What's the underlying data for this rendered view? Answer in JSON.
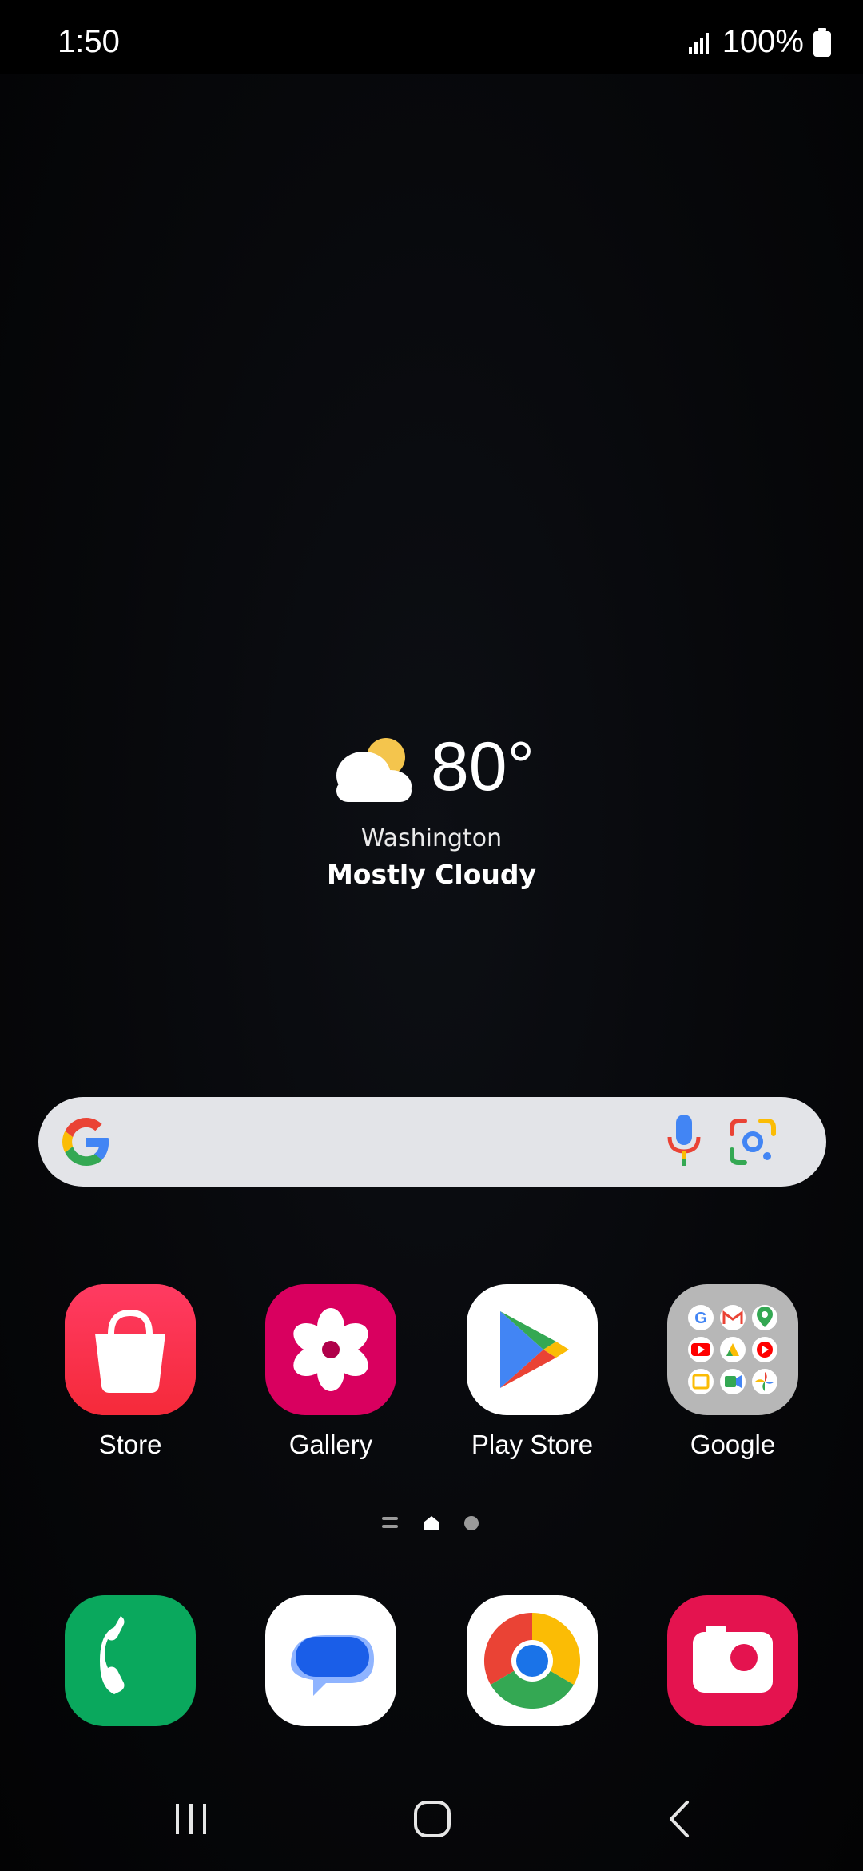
{
  "status_bar": {
    "time": "1:50",
    "battery": "100%",
    "icons": [
      "signal-icon",
      "battery-icon"
    ]
  },
  "weather": {
    "temperature": "80°",
    "city": "Washington",
    "condition": "Mostly Cloudy",
    "icon": "partly-cloudy-icon"
  },
  "search": {
    "icons": [
      "google-logo-icon",
      "microphone-icon",
      "google-lens-icon"
    ]
  },
  "apps": [
    {
      "label": "Store",
      "icon": "store-bag-icon",
      "color": "#ff2a57"
    },
    {
      "label": "Gallery",
      "icon": "gallery-flower-icon",
      "color": "#d9005f"
    },
    {
      "label": "Play Store",
      "icon": "play-store-icon",
      "color": "#ffffff"
    },
    {
      "label": "Google",
      "icon": "google-folder-icon",
      "color": "#b7b7b7"
    }
  ],
  "dock": [
    {
      "icon": "phone-icon",
      "color": "#0aa85d"
    },
    {
      "icon": "messages-icon",
      "color": "#ffffff"
    },
    {
      "icon": "chrome-icon",
      "color": "#ffffff"
    },
    {
      "icon": "camera-icon",
      "color": "#e4134f"
    }
  ],
  "nav": {
    "icons": [
      "recent-apps-icon",
      "home-icon",
      "back-icon"
    ]
  }
}
